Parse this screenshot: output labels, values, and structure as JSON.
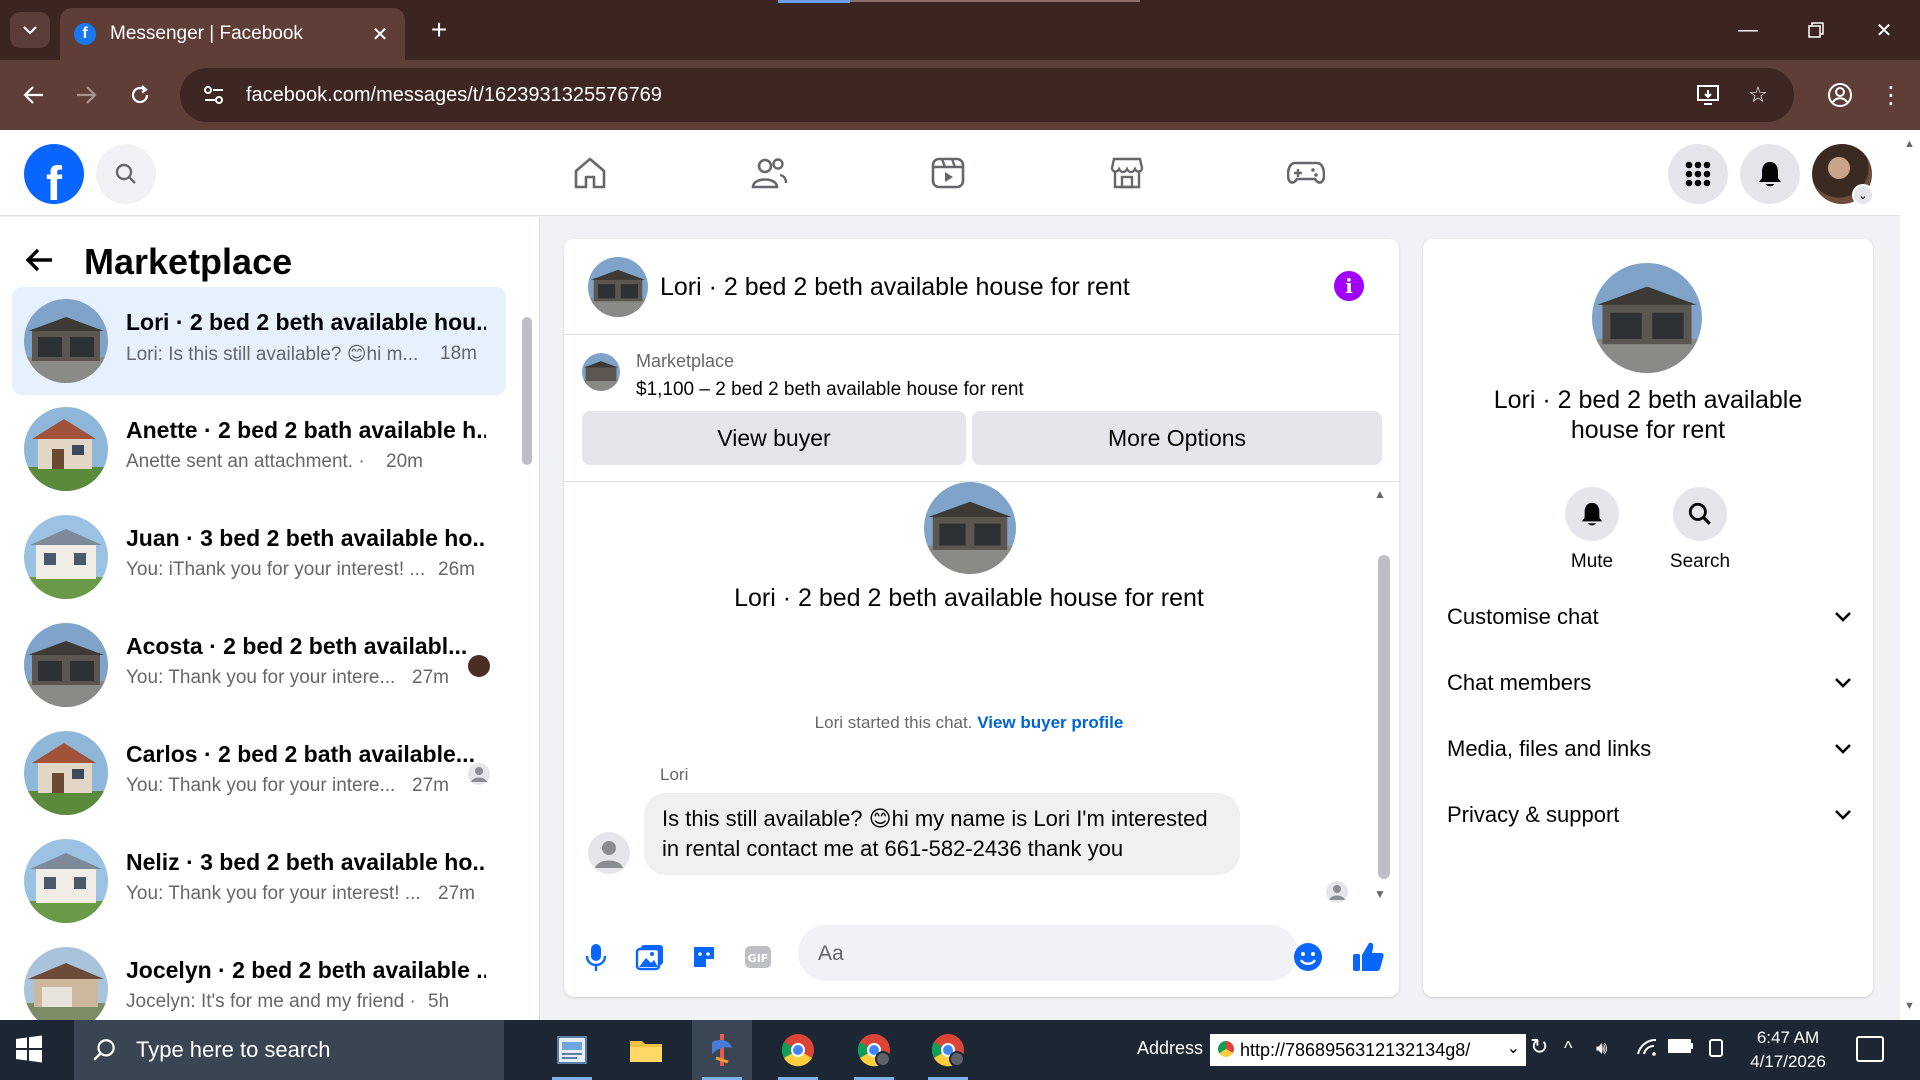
{
  "browser": {
    "tab_title": "Messenger | Facebook",
    "url": "facebook.com/messages/t/1623931325576769"
  },
  "sidebar": {
    "title": "Marketplace",
    "chats": [
      {
        "name": "Lori · 2 bed 2 beth available hou...",
        "preview": "Lori: Is this still available? 😊hi m...",
        "time": "18m"
      },
      {
        "name": "Anette · 2 bed 2 bath available h...",
        "preview": "Anette sent an attachment. ·",
        "time": "20m"
      },
      {
        "name": "Juan · 3 bed 2 beth available ho...",
        "preview": "You: iThank you for your interest! ...",
        "time": "26m"
      },
      {
        "name": "Acosta · 2 bed 2 beth availabl...",
        "preview": "You: Thank you for your intere...",
        "time": "27m"
      },
      {
        "name": "Carlos · 2 bed 2 bath available...",
        "preview": "You: Thank you for your intere...",
        "time": "27m"
      },
      {
        "name": "Neliz · 3 bed 2 beth available ho...",
        "preview": "You: Thank you for your interest! ...",
        "time": "27m"
      },
      {
        "name": "Jocelyn · 2 bed 2 beth available ...",
        "preview": "Jocelyn: It's for me and my friend ·",
        "time": "5h"
      }
    ]
  },
  "conversation": {
    "title": "Lori · 2 bed 2 beth available house for rent",
    "listing_label": "Marketplace",
    "listing_price": "$1,100 – 2 bed 2 beth available house for rent",
    "view_buyer": "View buyer",
    "more_options": "More Options",
    "intro_name": "Lori · 2 bed 2 beth available house for rent",
    "started_text": "Lori started this chat.",
    "started_link": "View buyer profile",
    "sender": "Lori",
    "message_line1": "Is this still available? 😊hi my name is Lori  I'm interested",
    "message_line2": "in rental contact me at 661-582-2436 thank you",
    "composer_placeholder": "Aa"
  },
  "info_panel": {
    "name_line1": "Lori · 2 bed 2 beth available",
    "name_line2": "house for rent",
    "mute": "Mute",
    "search": "Search",
    "sections": [
      "Customise chat",
      "Chat members",
      "Media, files and links",
      "Privacy & support"
    ]
  },
  "taskbar": {
    "search_placeholder": "Type here to search",
    "address_label": "Address",
    "address_value": "http://7868956312132134g8/",
    "time": "6:47 AM",
    "date": "4/17/2026"
  },
  "colors": {
    "accent": "#0866ff",
    "info": "#a100ff",
    "link": "#0064d1",
    "active_chat": "#e7f0fd",
    "chrome_bg": "#3c2420"
  }
}
